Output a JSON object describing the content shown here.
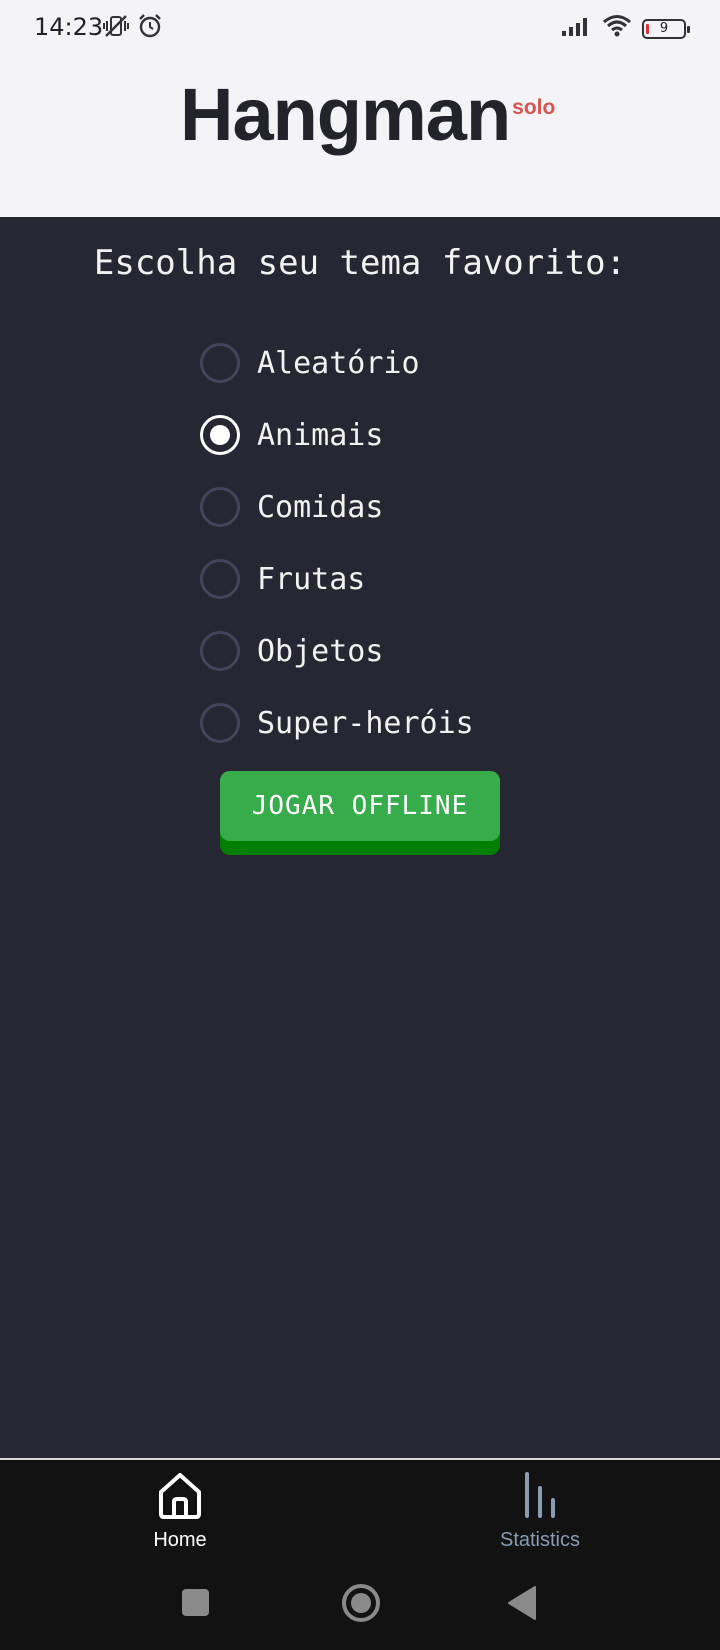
{
  "status": {
    "time": "14:23",
    "battery_level": "9"
  },
  "header": {
    "title": "Hangman",
    "subtitle": "solo"
  },
  "main": {
    "prompt": "Escolha seu tema favorito:",
    "themes": [
      {
        "label": "Aleatório",
        "selected": false
      },
      {
        "label": "Animais",
        "selected": true
      },
      {
        "label": "Comidas",
        "selected": false
      },
      {
        "label": "Frutas",
        "selected": false
      },
      {
        "label": "Objetos",
        "selected": false
      },
      {
        "label": "Super-heróis",
        "selected": false
      }
    ],
    "play_button_label": "JOGAR OFFLINE"
  },
  "bottom_nav": {
    "items": [
      {
        "label": "Home",
        "icon": "home-icon",
        "active": true
      },
      {
        "label": "Statistics",
        "icon": "bar-chart-icon",
        "active": false
      }
    ]
  },
  "colors": {
    "background": "#262733",
    "header_bg": "#f4f3f8",
    "accent_red": "#d9534f",
    "button_green": "#36ad4a",
    "button_shadow": "#007f00"
  }
}
